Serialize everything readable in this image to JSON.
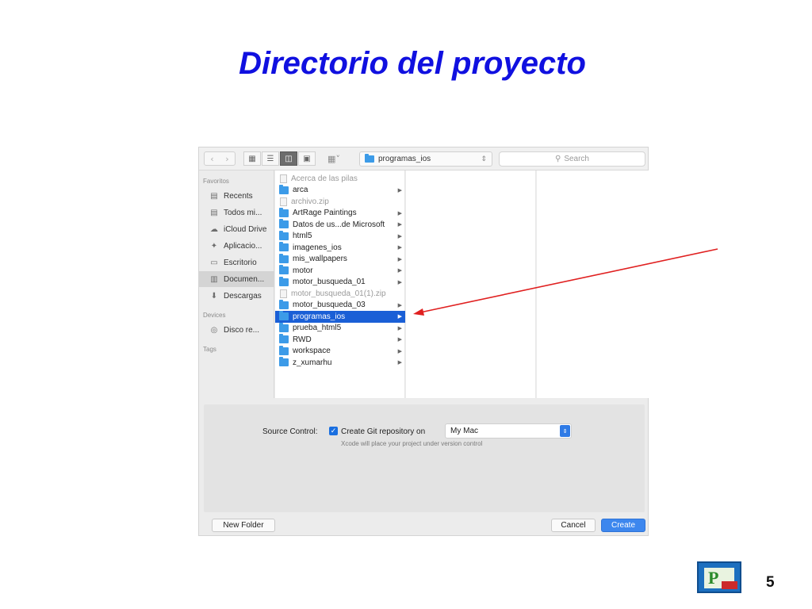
{
  "slide": {
    "title": "Directorio del proyecto",
    "page_number": "5"
  },
  "toolbar": {
    "back_icon": "chevron-left-icon",
    "forward_icon": "chevron-right-icon",
    "path_label": "programas_ios",
    "search_placeholder": "Search"
  },
  "sidebar": {
    "favorites_header": "Favoritos",
    "favorites": [
      {
        "label": "Recents",
        "icon": "recents-icon"
      },
      {
        "label": "Todos mi...",
        "icon": "all-files-icon"
      },
      {
        "label": "iCloud Drive",
        "icon": "cloud-icon"
      },
      {
        "label": "Aplicacio...",
        "icon": "applications-icon"
      },
      {
        "label": "Escritorio",
        "icon": "desktop-icon"
      },
      {
        "label": "Documen...",
        "icon": "documents-icon",
        "selected": true
      },
      {
        "label": "Descargas",
        "icon": "downloads-icon"
      }
    ],
    "devices_header": "Devices",
    "devices": [
      {
        "label": "Disco re...",
        "icon": "disk-icon"
      }
    ],
    "tags_header": "Tags"
  },
  "files": [
    {
      "name": "Acerca de las pilas",
      "type": "file",
      "dim": true
    },
    {
      "name": "arca",
      "type": "folder",
      "arrow": true
    },
    {
      "name": "archivo.zip",
      "type": "file",
      "dim": true
    },
    {
      "name": "ArtRage Paintings",
      "type": "folder",
      "arrow": true
    },
    {
      "name": "Datos de us...de Microsoft",
      "type": "folder",
      "arrow": true
    },
    {
      "name": "html5",
      "type": "folder",
      "arrow": true
    },
    {
      "name": "imagenes_ios",
      "type": "folder",
      "arrow": true
    },
    {
      "name": "mis_wallpapers",
      "type": "folder",
      "arrow": true
    },
    {
      "name": "motor",
      "type": "folder",
      "arrow": true
    },
    {
      "name": "motor_busqueda_01",
      "type": "folder",
      "arrow": true
    },
    {
      "name": "motor_busqueda_01(1).zip",
      "type": "file",
      "dim": true
    },
    {
      "name": "motor_busqueda_03",
      "type": "folder",
      "arrow": true
    },
    {
      "name": "programas_ios",
      "type": "folder",
      "arrow": true,
      "selected": true
    },
    {
      "name": "prueba_html5",
      "type": "folder",
      "arrow": true
    },
    {
      "name": "RWD",
      "type": "folder",
      "arrow": true
    },
    {
      "name": "workspace",
      "type": "folder",
      "arrow": true
    },
    {
      "name": "z_xumarhu",
      "type": "folder",
      "arrow": true
    }
  ],
  "options": {
    "source_control_label": "Source Control:",
    "git_checkbox_label": "Create Git repository on",
    "git_checked": true,
    "location_value": "My Mac",
    "hint": "Xcode will place your project under version control"
  },
  "buttons": {
    "new_folder": "New Folder",
    "cancel": "Cancel",
    "create": "Create"
  },
  "colors": {
    "title": "#1010e0",
    "selection": "#1a5fd6",
    "annotation_arrow": "#e02020",
    "primary_button": "#3d87ee"
  }
}
